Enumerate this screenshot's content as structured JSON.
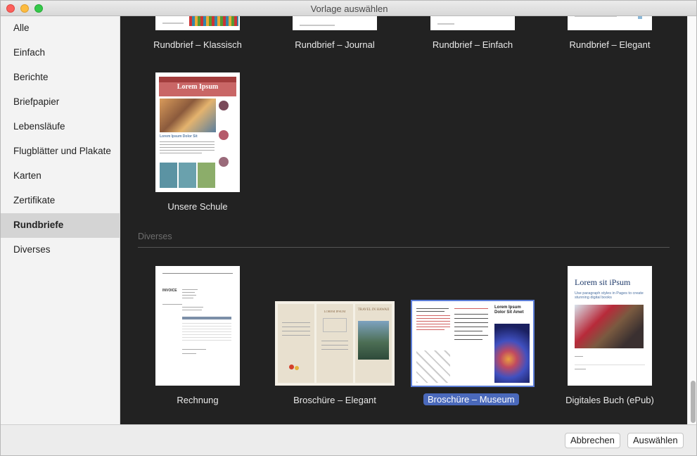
{
  "window": {
    "title": "Vorlage auswählen"
  },
  "sidebar": {
    "items": [
      {
        "label": "Alle"
      },
      {
        "label": "Einfach"
      },
      {
        "label": "Berichte"
      },
      {
        "label": "Briefpapier"
      },
      {
        "label": "Lebensläufe"
      },
      {
        "label": "Flugblätter und Plakate"
      },
      {
        "label": "Karten"
      },
      {
        "label": "Zertifikate"
      },
      {
        "label": "Rundbriefe",
        "selected": true
      },
      {
        "label": "Diverses"
      }
    ]
  },
  "gallery": {
    "rundbriefe": [
      {
        "label": "Rundbrief – Klassisch"
      },
      {
        "label": "Rundbrief – Journal"
      },
      {
        "label": "Rundbrief – Einfach"
      },
      {
        "label": "Rundbrief – Elegant"
      },
      {
        "label": "Unsere Schule",
        "heading": "Lorem Ipsum",
        "subheading": "Lorem Ipsum Dolor Sit"
      }
    ],
    "diverses_title": "Diverses",
    "diverses": [
      {
        "label": "Rechnung",
        "doc_title": "INVOICE"
      },
      {
        "label": "Broschüre – Elegant",
        "col2_heading": "LOREM IPSUM",
        "col3_heading": "TRAVEL IN HAWAII"
      },
      {
        "label": "Broschüre – Museum",
        "selected": true,
        "panel_heading": "Lorem Ipsum Dolor Sit Amet"
      },
      {
        "label": "Digitales Buch (ePub)",
        "heading": "Lorem sit iPsum",
        "subheading": "Use paragraph styles in Pages to create stunning digital books"
      }
    ]
  },
  "footer": {
    "cancel_label": "Abbrechen",
    "choose_label": "Auswählen"
  },
  "colors": {
    "accent": "#4a69bb",
    "gallery_bg": "#222222",
    "sidebar_selected": "#d4d4d4"
  }
}
